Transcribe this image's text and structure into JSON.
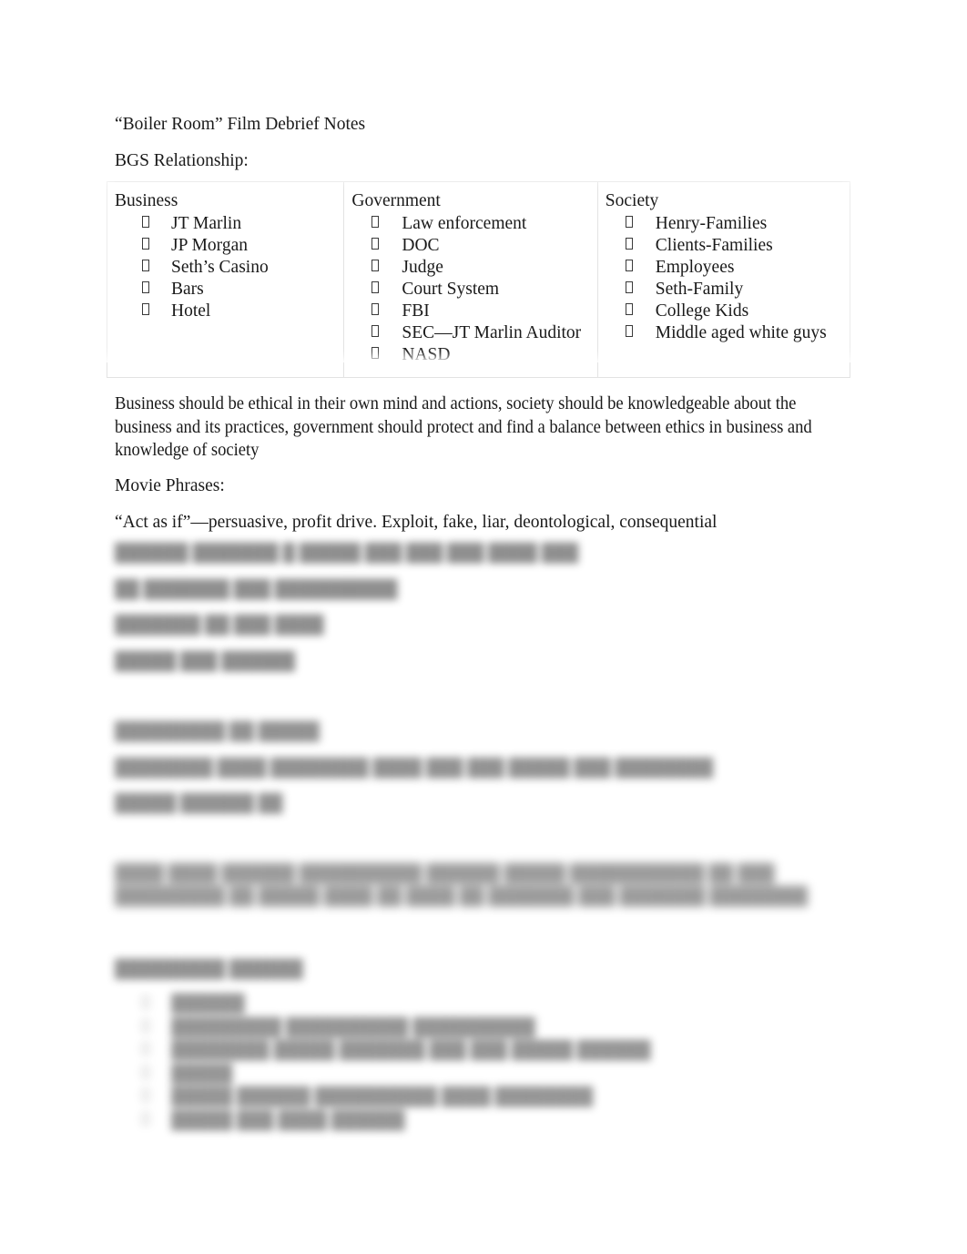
{
  "document": {
    "title_line": "“Boiler Room” Film Debrief Notes",
    "section_label": "BGS Relationship:"
  },
  "bgs_table": {
    "columns": [
      {
        "header": "Business",
        "items": [
          "JT Marlin",
          "JP Morgan",
          "Seth’s Casino",
          "Bars",
          "Hotel"
        ]
      },
      {
        "header": "Government",
        "items": [
          "Law enforcement",
          "DOC",
          "Judge",
          "Court System",
          "FBI",
          "SEC—JT Marlin Auditor",
          "NASD"
        ]
      },
      {
        "header": "Society",
        "items": [
          "Henry-Families",
          "Clients-Families",
          "Employees",
          "Seth-Family",
          "College Kids",
          "Middle aged white guys"
        ]
      }
    ]
  },
  "summary_paragraph": "Business should be ethical in their own mind and actions, society should be knowledgeable about the business and its practices, government should protect and find a balance between ethics in business and knowledge of society",
  "movie_phrases": {
    "heading": "Movie Phrases:",
    "first_phrase": "“Act as if”—persuasive, profit drive. Exploit, fake, liar, deontological, consequential"
  },
  "redacted": {
    "note": "illegible",
    "group_a": [
      "██████ ███████  █ █████ ███ ███ ███ ████ ███",
      "██ ███████ ███ ██████████",
      "███████ ██ ███ ████",
      "█████ ███ ██████"
    ],
    "group_b": [
      "█████████ ██ █████",
      "████████ ████ ████████ ████ ███ ███ █████ ███ ████████",
      "█████ ██████ ██"
    ],
    "group_c": "████ ████ ██████  ██████████ ██████ █████ ███████████ ██ ███ █████████ ██ █████ ████ ██ ████ ██ ███████ ███ ███████ ████████",
    "group_d_heading": "█████████ ██████",
    "group_d_items": [
      "██████",
      "█████████ ██████████  ██████████",
      "████████ █████ ███████ ███ ███ █████ ██████",
      "█████",
      "█████ ██████ ██████████ ████ ████████",
      "█████ ███ ████ ██████"
    ]
  }
}
